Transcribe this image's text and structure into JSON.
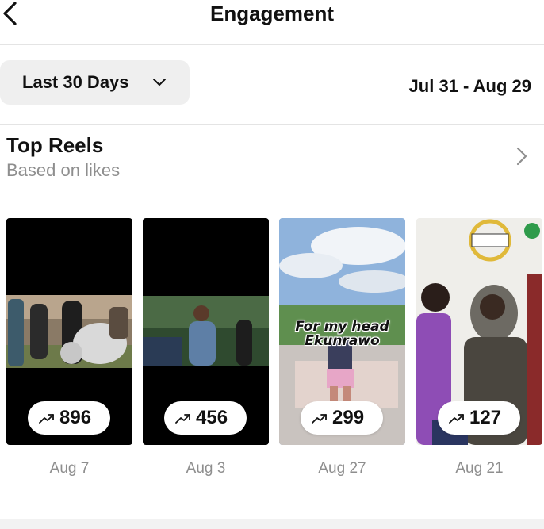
{
  "header": {
    "title": "Engagement"
  },
  "filter": {
    "range_label": "Last 30 Days",
    "date_range": "Jul 31 - Aug 29"
  },
  "section": {
    "title": "Top Reels",
    "subtitle": "Based on likes"
  },
  "reels": [
    {
      "value": "896",
      "date": "Aug 7"
    },
    {
      "value": "456",
      "date": "Aug 3"
    },
    {
      "value": "299",
      "date": "Aug 27",
      "overlay_text": "For my head Ekunrawo"
    },
    {
      "value": "127",
      "date": "Aug 21"
    }
  ],
  "icons": {
    "back": "back-arrow-icon",
    "dropdown": "chevron-down-icon",
    "section": "chevron-right-icon",
    "trend": "trending-up-icon"
  },
  "colors": {
    "text": "#111111",
    "muted": "#8e8e8e",
    "pill_bg": "#efefef",
    "divider": "#e4e4e4"
  }
}
